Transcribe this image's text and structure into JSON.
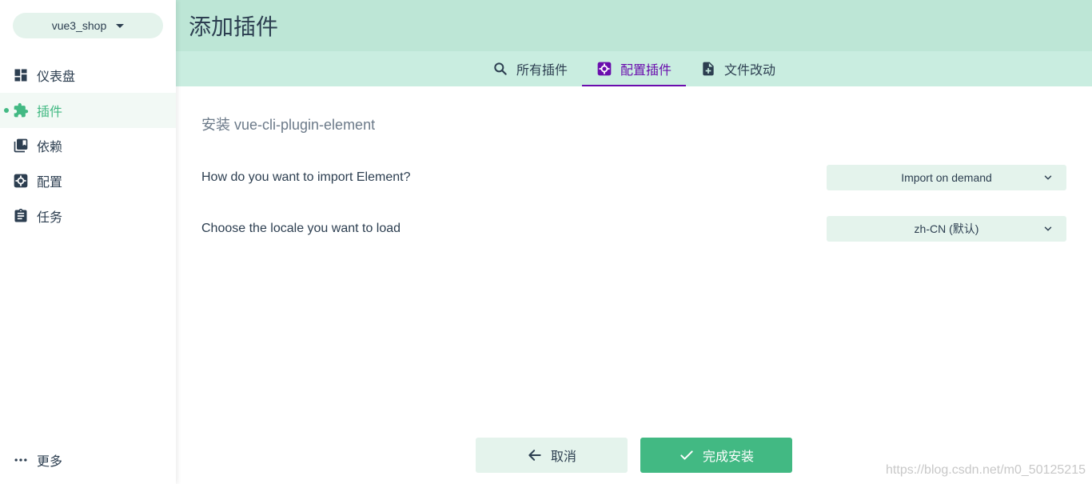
{
  "sidebar": {
    "project": "vue3_shop",
    "items": [
      {
        "label": "仪表盘",
        "icon": "dashboard-icon"
      },
      {
        "label": "插件",
        "icon": "puzzle-icon",
        "active": true
      },
      {
        "label": "依赖",
        "icon": "library-icon"
      },
      {
        "label": "配置",
        "icon": "settings-icon"
      },
      {
        "label": "任务",
        "icon": "clipboard-icon"
      }
    ],
    "more": "更多"
  },
  "header": {
    "title": "添加插件"
  },
  "tabs": [
    {
      "label": "所有插件",
      "icon": "search-icon"
    },
    {
      "label": "配置插件",
      "icon": "settings-icon",
      "active": true
    },
    {
      "label": "文件改动",
      "icon": "file-add-icon"
    }
  ],
  "install": {
    "title": "安装 vue-cli-plugin-element",
    "prompts": [
      {
        "label": "How do you want to import Element?",
        "value": "Import on demand"
      },
      {
        "label": "Choose the locale you want to load",
        "value": "zh-CN (默认)"
      }
    ]
  },
  "actions": {
    "cancel": "取消",
    "finish": "完成安装"
  },
  "watermark": "https://blog.csdn.net/m0_50125215",
  "colors": {
    "accent": "#42b983",
    "active_tab": "#6a0dad",
    "topbar": "#bde6d6",
    "tabbar": "#c9ede0"
  }
}
